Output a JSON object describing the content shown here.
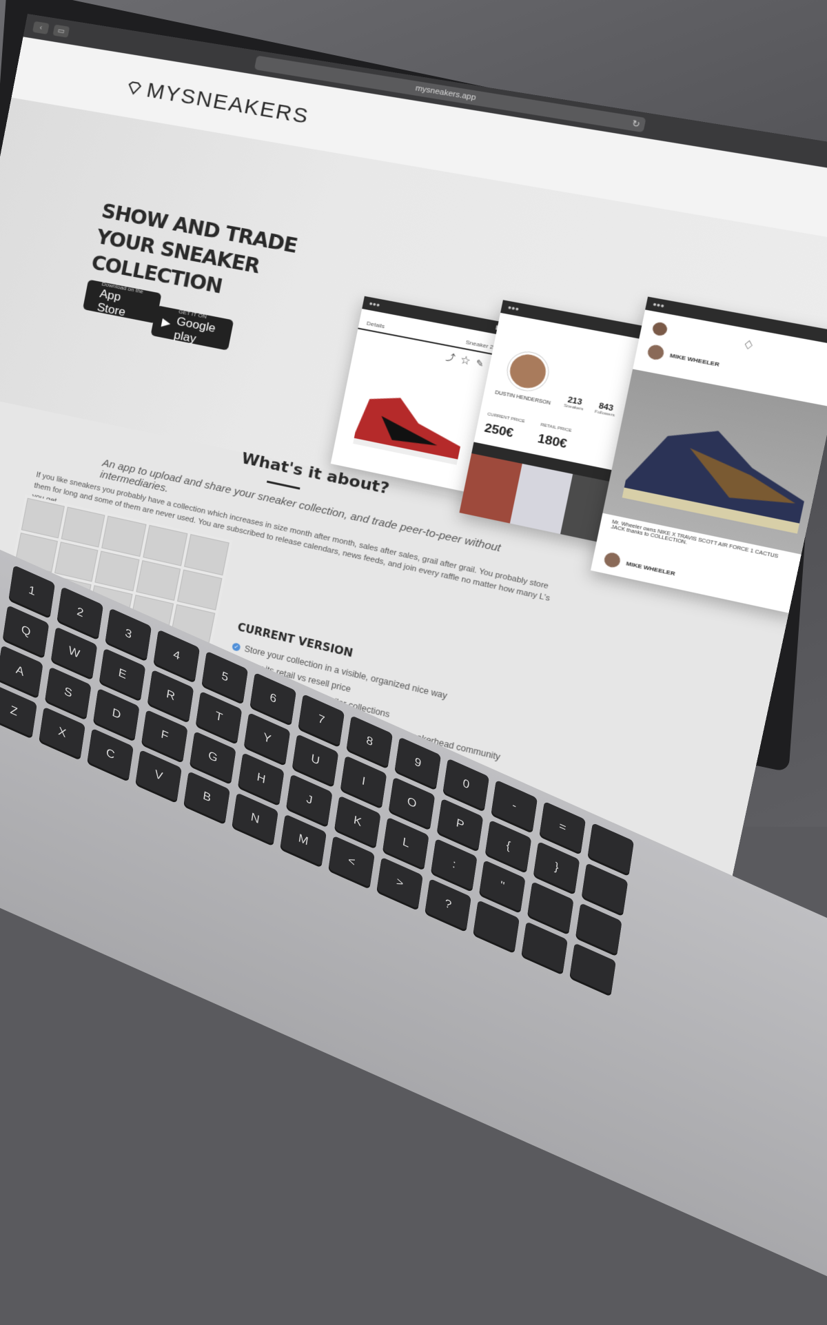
{
  "browser": {
    "url": "mysneakers.app"
  },
  "site": {
    "logo_text": "MYSNEAKERS",
    "hero_title": "SHOW AND TRADE YOUR SNEAKER COLLECTION",
    "app_store": {
      "small": "Download on the",
      "big": "App Store"
    },
    "google_play": {
      "small": "GET IT ON",
      "big": "Google play"
    }
  },
  "phones": {
    "p1": {
      "tab_left": "Details",
      "tab_right": "Sneaker 2"
    },
    "p2": {
      "name": "DUSTIN HENDERSON",
      "sneakers_count": "213",
      "sneakers_label": "Sneakers",
      "followers_count": "843",
      "followers_label": "Followers",
      "current_price_label": "CURRENT PRICE",
      "current_price": "250€",
      "retail_price_label": "RETAIL PRICE",
      "retail_price": "180€"
    },
    "p3": {
      "user": "MIKE WHEELER",
      "caption": "Mr. Wheeler owns NIKE X TRAVIS SCOTT AIR FORCE 1 CACTUS JACK thanks to COLLECTION.",
      "user2": "MIKE WHEELER"
    }
  },
  "about": {
    "title": "What's it about?",
    "subtitle": "An app to upload and share your sneaker collection, and trade peer-to-peer without intermediaries.",
    "body": "If you like sneakers you probably have a collection which increases in size month after month, sales after sales, grail after grail. You probably store them for long and some of them are never used. You are subscribed to release calendars, news feeds, and join every raffle no matter how many L's you get.",
    "version_title": "CURRENT VERSION",
    "features": [
      "Store your collection in a visible, organized nice way",
      "Know its retail vs resell price",
      "Find other users with similar collections",
      "Earn visibility and relevance in the growing sneakerhead community"
    ]
  },
  "keyboard": {
    "rows": [
      [
        "1",
        "2",
        "3",
        "4",
        "5",
        "6",
        "7",
        "8",
        "9",
        "0",
        "-",
        "="
      ],
      [
        "Q",
        "W",
        "E",
        "R",
        "T",
        "Y",
        "U",
        "I",
        "O",
        "P",
        "{",
        "}"
      ],
      [
        "A",
        "S",
        "D",
        "F",
        "G",
        "H",
        "J",
        "K",
        "L",
        ":",
        "\""
      ],
      [
        "Z",
        "X",
        "C",
        "V",
        "B",
        "N",
        "M",
        "<",
        ">",
        "?"
      ]
    ]
  },
  "colors": {
    "screen_bg": "#e6e6e6",
    "dark": "#2a2a2a",
    "accent_check": "#4f8fd8"
  }
}
